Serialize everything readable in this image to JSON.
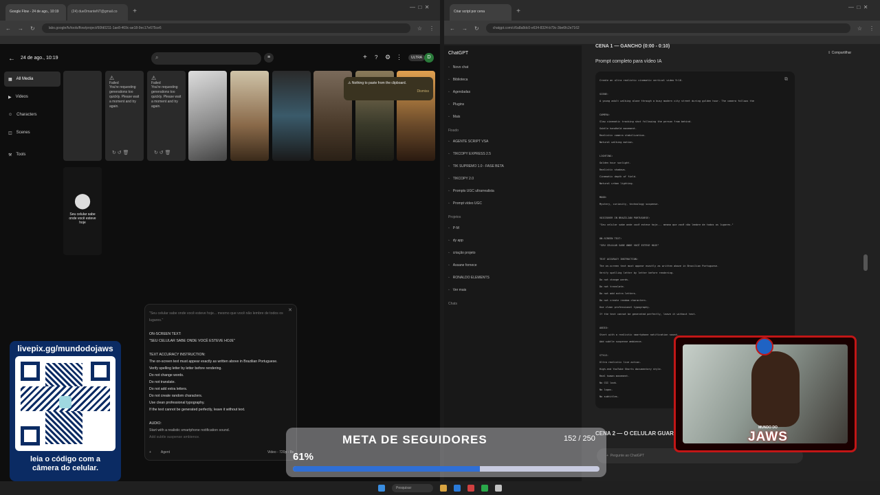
{
  "left_browser": {
    "tabs": [
      {
        "label": "Google Flow - 24 de ago., 10:19"
      },
      {
        "label": "(24) dueDmanteNT@gmail.co"
      }
    ],
    "url": "labs.google/fx/tools/flow/project/60fd0211-1ae8-469c-ae18-9ec17e675ce6",
    "app": {
      "title": "24 de ago., 10:19",
      "account_badge": "ULTRA",
      "avatar_letter": "D"
    },
    "sidebar": [
      {
        "label": "All Media"
      },
      {
        "label": "Videos"
      },
      {
        "label": "Characters"
      },
      {
        "label": "Scenes"
      },
      {
        "label": "Tools"
      }
    ],
    "failed_card": {
      "title": "Failed",
      "message": "You're requesting generations too quickly. Please wait a moment and try again."
    },
    "toast": {
      "message": "Nothing to paste from the clipboard.",
      "action": "Dismiss"
    },
    "map_card_text": "Seu celular sabe onde você esteve hoje",
    "prompt_lines": [
      "\"Seu celular sabe onde você esteve hoje... mesmo que você não lembre de todos os",
      "lugares.\"",
      "",
      "ON-SCREEN TEXT:",
      "\"SEU CELULAR SABE ONDE VOCÊ ESTEVE HOJE\"",
      "",
      "TEXT ACCURACY INSTRUCTION:",
      "The on-screen text must appear exactly as written above in Brazilian Portuguese.",
      "Verify spelling letter by letter before rendering.",
      "Do not change words.",
      "Do not translate.",
      "Do not add extra letters.",
      "Do not create random characters.",
      "Use clean professional typography.",
      "If the text cannot be generated perfectly, leave it without text.",
      "",
      "AUDIO:",
      "Start with a realistic smartphone notification sound.",
      "Add subtle suspense ambience."
    ],
    "prompt_footer": {
      "agent_label": "Agent",
      "model_label": "Video - 720p - 8s"
    }
  },
  "right_browser": {
    "tab": "Criar script por cena",
    "url": "chatgpt.com/c/6a8a8dc0-e634-8324-b79c-3be6fc2e7162",
    "app_title": "ChatGPT",
    "share_label": "Compartilhar",
    "nav": [
      {
        "label": "Novo chat"
      },
      {
        "label": "Biblioteca"
      },
      {
        "label": "Agendadas"
      },
      {
        "label": "Plugins"
      },
      {
        "label": "Mais"
      }
    ],
    "pinned_title": "Fixado",
    "pinned": [
      {
        "label": "AGENTE SCRIPT VSA"
      },
      {
        "label": "TIKCOPY EXPRESS 2.5"
      },
      {
        "label": "TIK SUPREMO 1.0 - FASE BETA"
      },
      {
        "label": "TIKCOPY 2.0"
      },
      {
        "label": "Prompts UGC ultrarrealista"
      },
      {
        "label": "Prompt vídeo UGC"
      }
    ],
    "projects_title": "Projetos",
    "projects": [
      {
        "label": "P-M"
      },
      {
        "label": "dy app"
      },
      {
        "label": "criação projeto"
      },
      {
        "label": "Assane fornece"
      },
      {
        "label": "RONALDO ELEMENTS"
      },
      {
        "label": "Ver mais"
      }
    ],
    "chats_title": "Chats",
    "scene_heading": "CENA 1 — GANCHO (0:00 - 0:10)",
    "prompt_heading": "Prompt completo para vídeo IA",
    "code_lines": [
      "Create an ultra realistic cinematic vertical video 9:16.",
      "",
      "SCENE:",
      "A young adult walking alone through a busy modern city street during golden hour. The camera follows the",
      "",
      "CAMERA:",
      "Slow cinematic tracking shot following the person from behind.",
      "Subtle handheld movement.",
      "Realistic camera stabilization.",
      "Natural walking motion.",
      "",
      "LIGHTING:",
      "Golden hour sunlight.",
      "Realistic shadows.",
      "Cinematic depth of field.",
      "Natural urban lighting.",
      "",
      "MOOD:",
      "Mystery, curiosity, technology suspense.",
      "",
      "VOICEOVER IN BRAZILIAN PORTUGUESE:",
      "\"Seu celular sabe onde você esteve hoje... mesmo que você não lembre de todos os lugares.\"",
      "",
      "ON-SCREEN TEXT:",
      "\"SEU CELULAR SABE ONDE VOCÊ ESTEVE HOJE\"",
      "",
      "TEXT ACCURACY INSTRUCTION:",
      "The on-screen text must appear exactly as written above in Brazilian Portuguese.",
      "Verify spelling letter by letter before rendering.",
      "Do not change words.",
      "Do not translate.",
      "Do not add extra letters.",
      "Do not create random characters.",
      "Use clean professional typography.",
      "If the text cannot be generated perfectly, leave it without text.",
      "",
      "AUDIO:",
      "Start with a realistic smartphone notification sound.",
      "Add subtle suspense ambience.",
      "",
      "STYLE:",
      "Ultra realistic live action.",
      "High-end YouTube Shorts documentary style.",
      "Real human movement.",
      "No CGI look.",
      "No logos.",
      "No subtitles."
    ],
    "next_scene": "CENA 2 — O CELULAR GUARDA",
    "composer_placeholder": "Pergunte ao ChatGPT"
  },
  "overlay_qr": {
    "url": "livepix.gg/mundodojaws",
    "caption_1": "leia o código com a",
    "caption_2": "câmera do celular."
  },
  "overlay_goal": {
    "title": "META DE SEGUIDORES",
    "count": "152 / 250",
    "percent_label": "61%",
    "progress": 0.61
  },
  "overlay_cam": {
    "brand_top": "MUNDO DO",
    "brand_main": "JAWS"
  },
  "taskbar": {
    "search": "Pesquisar"
  },
  "colors": {
    "accent_blue": "#2f6fd6",
    "cam_red": "#c21616",
    "qr_blue": "#0b2b63"
  }
}
